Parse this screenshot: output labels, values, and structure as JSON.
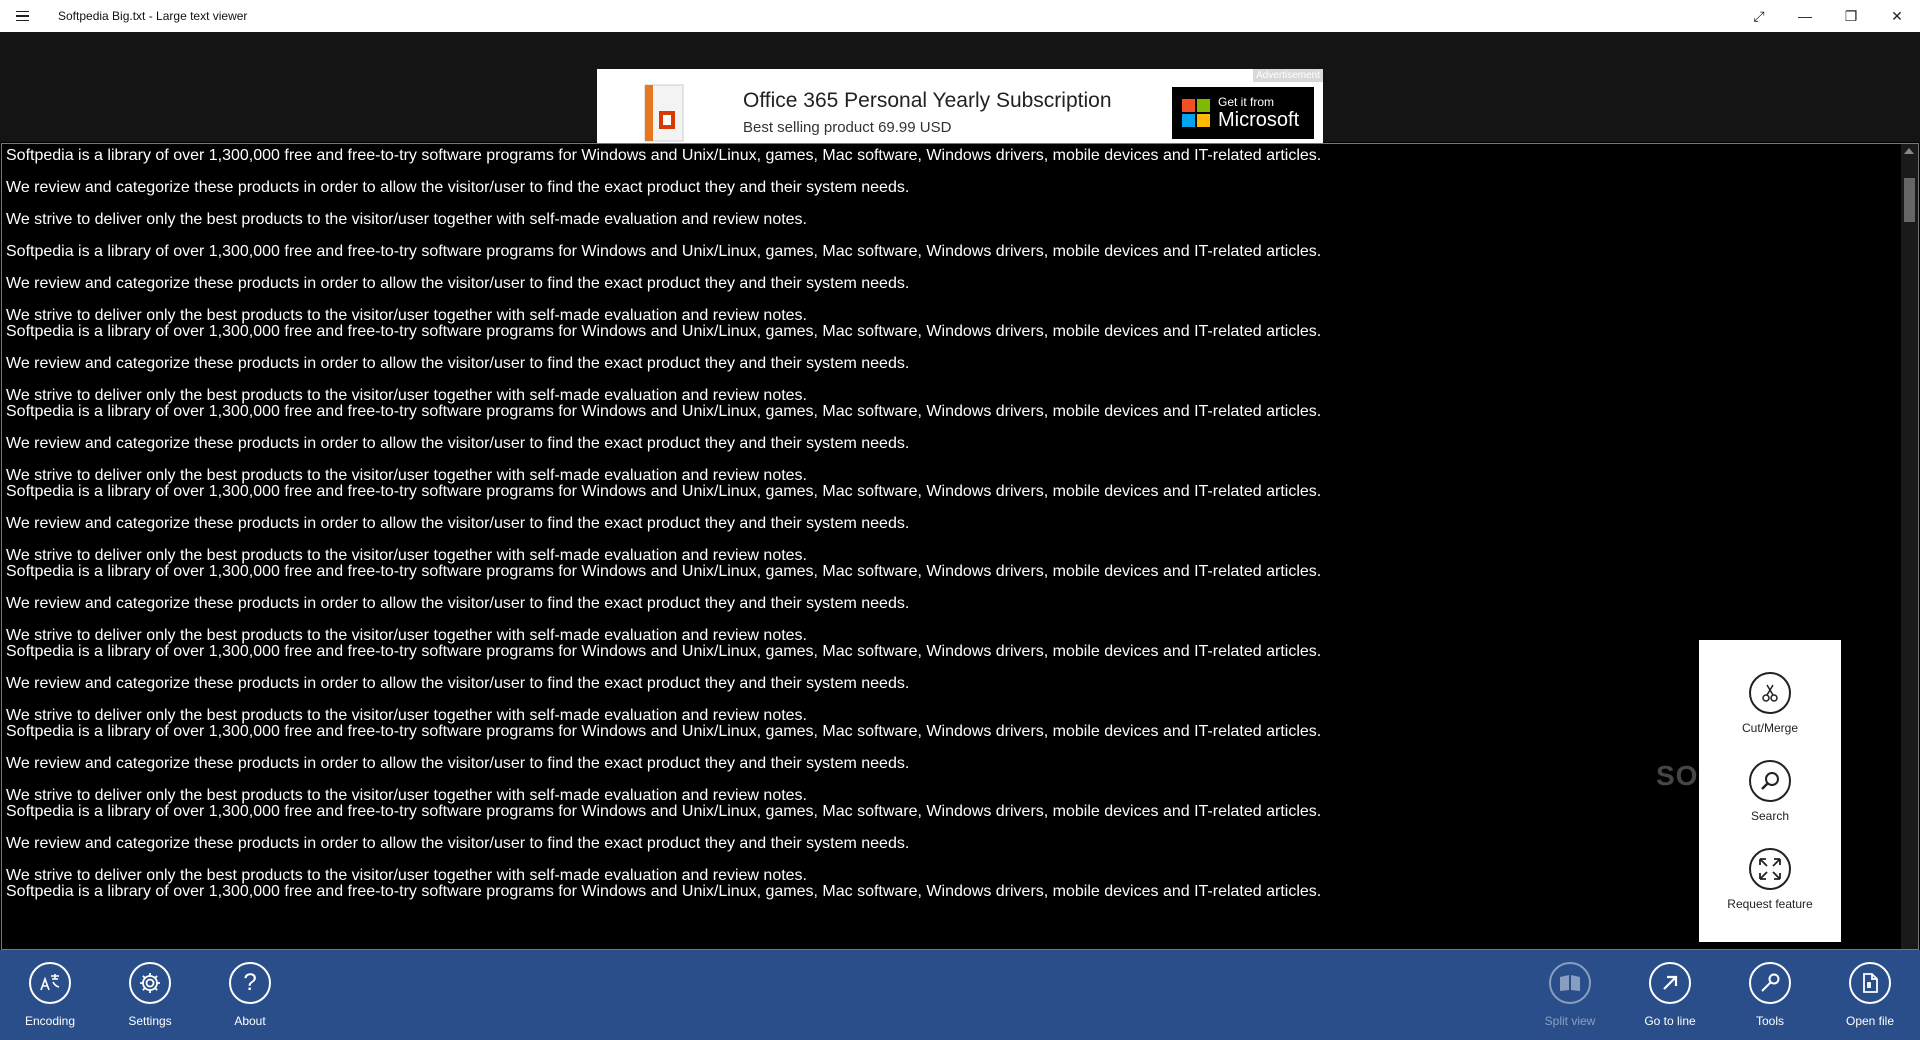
{
  "window": {
    "title": "Softpedia Big.txt - Large text viewer",
    "controls": {
      "fullscreen": "⤢",
      "minimize": "—",
      "restore": "❐",
      "close": "✕"
    }
  },
  "ad": {
    "label": "Advertisement",
    "title": "Office 365 Personal Yearly Subscription",
    "subtitle": "Best selling product   69.99 USD",
    "cta_small": "Get it from",
    "cta_big": "Microsoft",
    "colors": {
      "red": "#f25022",
      "green": "#7fba00",
      "blue": "#00a4ef",
      "yellow": "#ffb900"
    }
  },
  "viewer": {
    "lines": [
      "Softpedia is a library of over 1,300,000 free and free-to-try software programs for Windows and Unix/Linux, games, Mac software, Windows drivers, mobile devices and IT-related articles.",
      "We review and categorize these products in order to allow the visitor/user to find the exact product they and their system needs.",
      "We strive to deliver only the best products to the visitor/user together with self-made evaluation and review notes.",
      "Softpedia is a library of over 1,300,000 free and free-to-try software programs for Windows and Unix/Linux, games, Mac software, Windows drivers, mobile devices and IT-related articles.",
      "We review and categorize these products in order to allow the visitor/user to find the exact product they and their system needs.",
      "We strive to deliver only the best products to the visitor/user together with self-made evaluation and review notes.",
      "Softpedia is a library of over 1,300,000 free and free-to-try software programs for Windows and Unix/Linux, games, Mac software, Windows drivers, mobile devices and IT-related articles.",
      "We review and categorize these products in order to allow the visitor/user to find the exact product they and their system needs.",
      "We strive to deliver only the best products to the visitor/user together with self-made evaluation and review notes.",
      "Softpedia is a library of over 1,300,000 free and free-to-try software programs for Windows and Unix/Linux, games, Mac software, Windows drivers, mobile devices and IT-related articles.",
      "We review and categorize these products in order to allow the visitor/user to find the exact product they and their system needs.",
      "We strive to deliver only the best products to the visitor/user together with self-made evaluation and review notes.",
      "Softpedia is a library of over 1,300,000 free and free-to-try software programs for Windows and Unix/Linux, games, Mac software, Windows drivers, mobile devices and IT-related articles.",
      "We review and categorize these products in order to allow the visitor/user to find the exact product they and their system needs.",
      "We strive to deliver only the best products to the visitor/user together with self-made evaluation and review notes.",
      "Softpedia is a library of over 1,300,000 free and free-to-try software programs for Windows and Unix/Linux, games, Mac software, Windows drivers, mobile devices and IT-related articles.",
      "We review and categorize these products in order to allow the visitor/user to find the exact product they and their system needs.",
      "We strive to deliver only the best products to the visitor/user together with self-made evaluation and review notes.",
      "Softpedia is a library of over 1,300,000 free and free-to-try software programs for Windows and Unix/Linux, games, Mac software, Windows drivers, mobile devices and IT-related articles.",
      "We review and categorize these products in order to allow the visitor/user to find the exact product they and their system needs.",
      "We strive to deliver only the best products to the visitor/user together with self-made evaluation and review notes.",
      "Softpedia is a library of over 1,300,000 free and free-to-try software programs for Windows and Unix/Linux, games, Mac software, Windows drivers, mobile devices and IT-related articles.",
      "We review and categorize these products in order to allow the visitor/user to find the exact product they and their system needs.",
      "We strive to deliver only the best products to the visitor/user together with self-made evaluation and review notes.",
      "Softpedia is a library of over 1,300,000 free and free-to-try software programs for Windows and Unix/Linux, games, Mac software, Windows drivers, mobile devices and IT-related articles.",
      "We review and categorize these products in order to allow the visitor/user to find the exact product they and their system needs.",
      "We strive to deliver only the best products to the visitor/user together with self-made evaluation and review notes.",
      "Softpedia is a library of over 1,300,000 free and free-to-try software programs for Windows and Unix/Linux, games, Mac software, Windows drivers, mobile devices and IT-related articles."
    ]
  },
  "tools_popup": {
    "items": [
      {
        "label": "Cut/Merge",
        "icon": "scissors-icon"
      },
      {
        "label": "Search",
        "icon": "search-icon"
      },
      {
        "label": "Request feature",
        "icon": "expand-arrows-icon"
      }
    ]
  },
  "watermark": "SOFTPEDIA",
  "appbar": {
    "left": [
      {
        "label": "Encoding",
        "icon": "encoding-icon"
      },
      {
        "label": "Settings",
        "icon": "gear-icon"
      },
      {
        "label": "About",
        "icon": "question-icon"
      }
    ],
    "right": [
      {
        "label": "Split view",
        "icon": "split-view-icon",
        "enabled": false
      },
      {
        "label": "Go to line",
        "icon": "arrow-up-right-icon",
        "enabled": true
      },
      {
        "label": "Tools",
        "icon": "wrench-icon",
        "enabled": true
      },
      {
        "label": "Open file",
        "icon": "open-file-icon",
        "enabled": true
      }
    ],
    "color": "#2d5596"
  }
}
